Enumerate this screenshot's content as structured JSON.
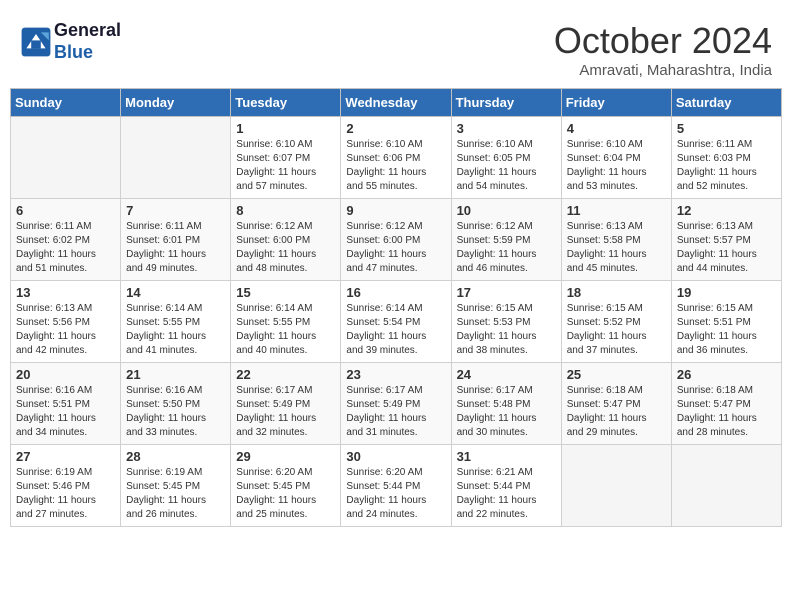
{
  "header": {
    "logo_line1": "General",
    "logo_line2": "Blue",
    "month": "October 2024",
    "location": "Amravati, Maharashtra, India"
  },
  "days_of_week": [
    "Sunday",
    "Monday",
    "Tuesday",
    "Wednesday",
    "Thursday",
    "Friday",
    "Saturday"
  ],
  "weeks": [
    [
      {
        "day": "",
        "info": ""
      },
      {
        "day": "",
        "info": ""
      },
      {
        "day": "1",
        "info": "Sunrise: 6:10 AM\nSunset: 6:07 PM\nDaylight: 11 hours and 57 minutes."
      },
      {
        "day": "2",
        "info": "Sunrise: 6:10 AM\nSunset: 6:06 PM\nDaylight: 11 hours and 55 minutes."
      },
      {
        "day": "3",
        "info": "Sunrise: 6:10 AM\nSunset: 6:05 PM\nDaylight: 11 hours and 54 minutes."
      },
      {
        "day": "4",
        "info": "Sunrise: 6:10 AM\nSunset: 6:04 PM\nDaylight: 11 hours and 53 minutes."
      },
      {
        "day": "5",
        "info": "Sunrise: 6:11 AM\nSunset: 6:03 PM\nDaylight: 11 hours and 52 minutes."
      }
    ],
    [
      {
        "day": "6",
        "info": "Sunrise: 6:11 AM\nSunset: 6:02 PM\nDaylight: 11 hours and 51 minutes."
      },
      {
        "day": "7",
        "info": "Sunrise: 6:11 AM\nSunset: 6:01 PM\nDaylight: 11 hours and 49 minutes."
      },
      {
        "day": "8",
        "info": "Sunrise: 6:12 AM\nSunset: 6:00 PM\nDaylight: 11 hours and 48 minutes."
      },
      {
        "day": "9",
        "info": "Sunrise: 6:12 AM\nSunset: 6:00 PM\nDaylight: 11 hours and 47 minutes."
      },
      {
        "day": "10",
        "info": "Sunrise: 6:12 AM\nSunset: 5:59 PM\nDaylight: 11 hours and 46 minutes."
      },
      {
        "day": "11",
        "info": "Sunrise: 6:13 AM\nSunset: 5:58 PM\nDaylight: 11 hours and 45 minutes."
      },
      {
        "day": "12",
        "info": "Sunrise: 6:13 AM\nSunset: 5:57 PM\nDaylight: 11 hours and 44 minutes."
      }
    ],
    [
      {
        "day": "13",
        "info": "Sunrise: 6:13 AM\nSunset: 5:56 PM\nDaylight: 11 hours and 42 minutes."
      },
      {
        "day": "14",
        "info": "Sunrise: 6:14 AM\nSunset: 5:55 PM\nDaylight: 11 hours and 41 minutes."
      },
      {
        "day": "15",
        "info": "Sunrise: 6:14 AM\nSunset: 5:55 PM\nDaylight: 11 hours and 40 minutes."
      },
      {
        "day": "16",
        "info": "Sunrise: 6:14 AM\nSunset: 5:54 PM\nDaylight: 11 hours and 39 minutes."
      },
      {
        "day": "17",
        "info": "Sunrise: 6:15 AM\nSunset: 5:53 PM\nDaylight: 11 hours and 38 minutes."
      },
      {
        "day": "18",
        "info": "Sunrise: 6:15 AM\nSunset: 5:52 PM\nDaylight: 11 hours and 37 minutes."
      },
      {
        "day": "19",
        "info": "Sunrise: 6:15 AM\nSunset: 5:51 PM\nDaylight: 11 hours and 36 minutes."
      }
    ],
    [
      {
        "day": "20",
        "info": "Sunrise: 6:16 AM\nSunset: 5:51 PM\nDaylight: 11 hours and 34 minutes."
      },
      {
        "day": "21",
        "info": "Sunrise: 6:16 AM\nSunset: 5:50 PM\nDaylight: 11 hours and 33 minutes."
      },
      {
        "day": "22",
        "info": "Sunrise: 6:17 AM\nSunset: 5:49 PM\nDaylight: 11 hours and 32 minutes."
      },
      {
        "day": "23",
        "info": "Sunrise: 6:17 AM\nSunset: 5:49 PM\nDaylight: 11 hours and 31 minutes."
      },
      {
        "day": "24",
        "info": "Sunrise: 6:17 AM\nSunset: 5:48 PM\nDaylight: 11 hours and 30 minutes."
      },
      {
        "day": "25",
        "info": "Sunrise: 6:18 AM\nSunset: 5:47 PM\nDaylight: 11 hours and 29 minutes."
      },
      {
        "day": "26",
        "info": "Sunrise: 6:18 AM\nSunset: 5:47 PM\nDaylight: 11 hours and 28 minutes."
      }
    ],
    [
      {
        "day": "27",
        "info": "Sunrise: 6:19 AM\nSunset: 5:46 PM\nDaylight: 11 hours and 27 minutes."
      },
      {
        "day": "28",
        "info": "Sunrise: 6:19 AM\nSunset: 5:45 PM\nDaylight: 11 hours and 26 minutes."
      },
      {
        "day": "29",
        "info": "Sunrise: 6:20 AM\nSunset: 5:45 PM\nDaylight: 11 hours and 25 minutes."
      },
      {
        "day": "30",
        "info": "Sunrise: 6:20 AM\nSunset: 5:44 PM\nDaylight: 11 hours and 24 minutes."
      },
      {
        "day": "31",
        "info": "Sunrise: 6:21 AM\nSunset: 5:44 PM\nDaylight: 11 hours and 22 minutes."
      },
      {
        "day": "",
        "info": ""
      },
      {
        "day": "",
        "info": ""
      }
    ]
  ]
}
